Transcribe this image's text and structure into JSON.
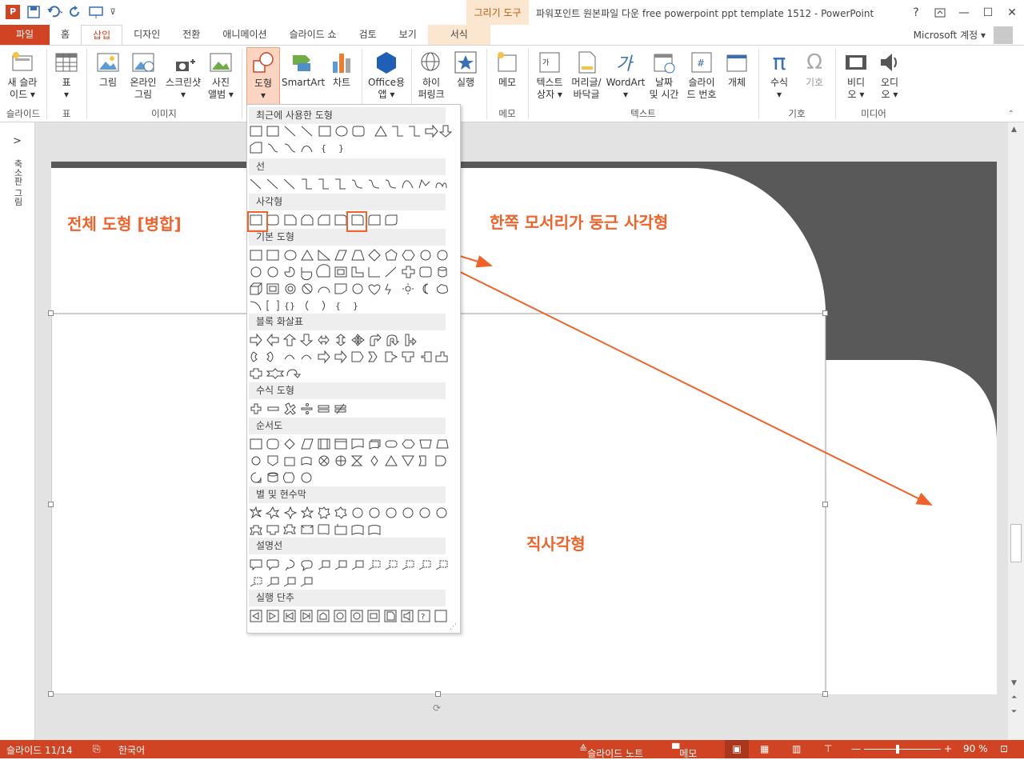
{
  "titlebar": {
    "context_tool": "그리기 도구",
    "doc_title": "파워포인트 원본파일 다운 free powerpoint ppt template 1512 - PowerPoint",
    "help": "?"
  },
  "tabs": {
    "file": "파일",
    "home": "홈",
    "insert": "삽입",
    "design": "디자인",
    "transitions": "전환",
    "animations": "애니메이션",
    "slideshow": "슬라이드 쇼",
    "review": "검토",
    "view": "보기",
    "format": "서식"
  },
  "account": "Microsoft 계정",
  "ribbon": {
    "new_slide": "새 슬라\n이드 ▾",
    "table": "표\n▾",
    "picture": "그림",
    "online_picture": "온라인\n그림",
    "screenshot": "스크린샷\n▾",
    "photo_album": "사진\n앨범 ▾",
    "shapes": "도형\n▾",
    "smartart": "SmartArt",
    "chart": "차트",
    "office_apps": "Office용\n앱 ▾",
    "hyperlink": "하이\n퍼링크",
    "action": "실행",
    "comment": "메모",
    "textbox": "텍스트\n상자 ▾",
    "header_footer": "머리글/\n바닥글",
    "wordart": "WordArt\n▾",
    "datetime": "날짜\n및 시간",
    "slide_number": "슬라이\n드 번호",
    "object": "개체",
    "equation": "수식\n▾",
    "symbol": "기호",
    "video": "비디\n오 ▾",
    "audio": "오디\n오 ▾",
    "groups": {
      "slides": "슬라이드",
      "tables": "표",
      "images": "이미지",
      "comments": "메모",
      "text": "텍스트",
      "symbols": "기호",
      "media": "미디어"
    }
  },
  "thumbpane": {
    "label": "축소판 그림",
    "arrow": ">"
  },
  "dropdown": {
    "categories": [
      "최근에 사용한 도형",
      "선",
      "사각형",
      "기본 도형",
      "블록 화살표",
      "수식 도형",
      "순서도",
      "별 및 현수막",
      "설명선",
      "실행 단추"
    ]
  },
  "annotations": {
    "merge": "전체 도형 [병합]",
    "rounded": "한쪽 모서리가 둥근 사각형",
    "rect": "직사각형"
  },
  "status": {
    "slide": "슬라이드 11/14",
    "lang": "한국어",
    "notes": "슬라이드 노트",
    "comments": "메모",
    "zoom": "90 %"
  },
  "colors": {
    "accent": "#d04423",
    "annotation": "#f0622a",
    "dark_shape": "#595959"
  }
}
